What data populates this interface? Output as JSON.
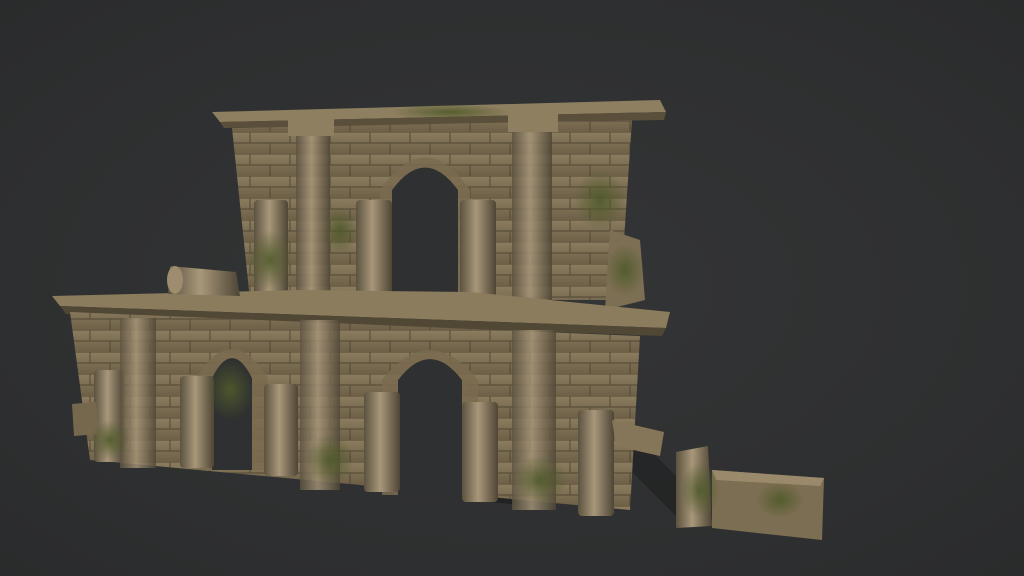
{
  "scene": {
    "subject": "ruined-stone-arcade-3d-model",
    "background_color": "#2f3031",
    "stone_color": "#8a7a5c",
    "stone_dark": "#4a4030",
    "moss_color": "#4f5a2a"
  }
}
